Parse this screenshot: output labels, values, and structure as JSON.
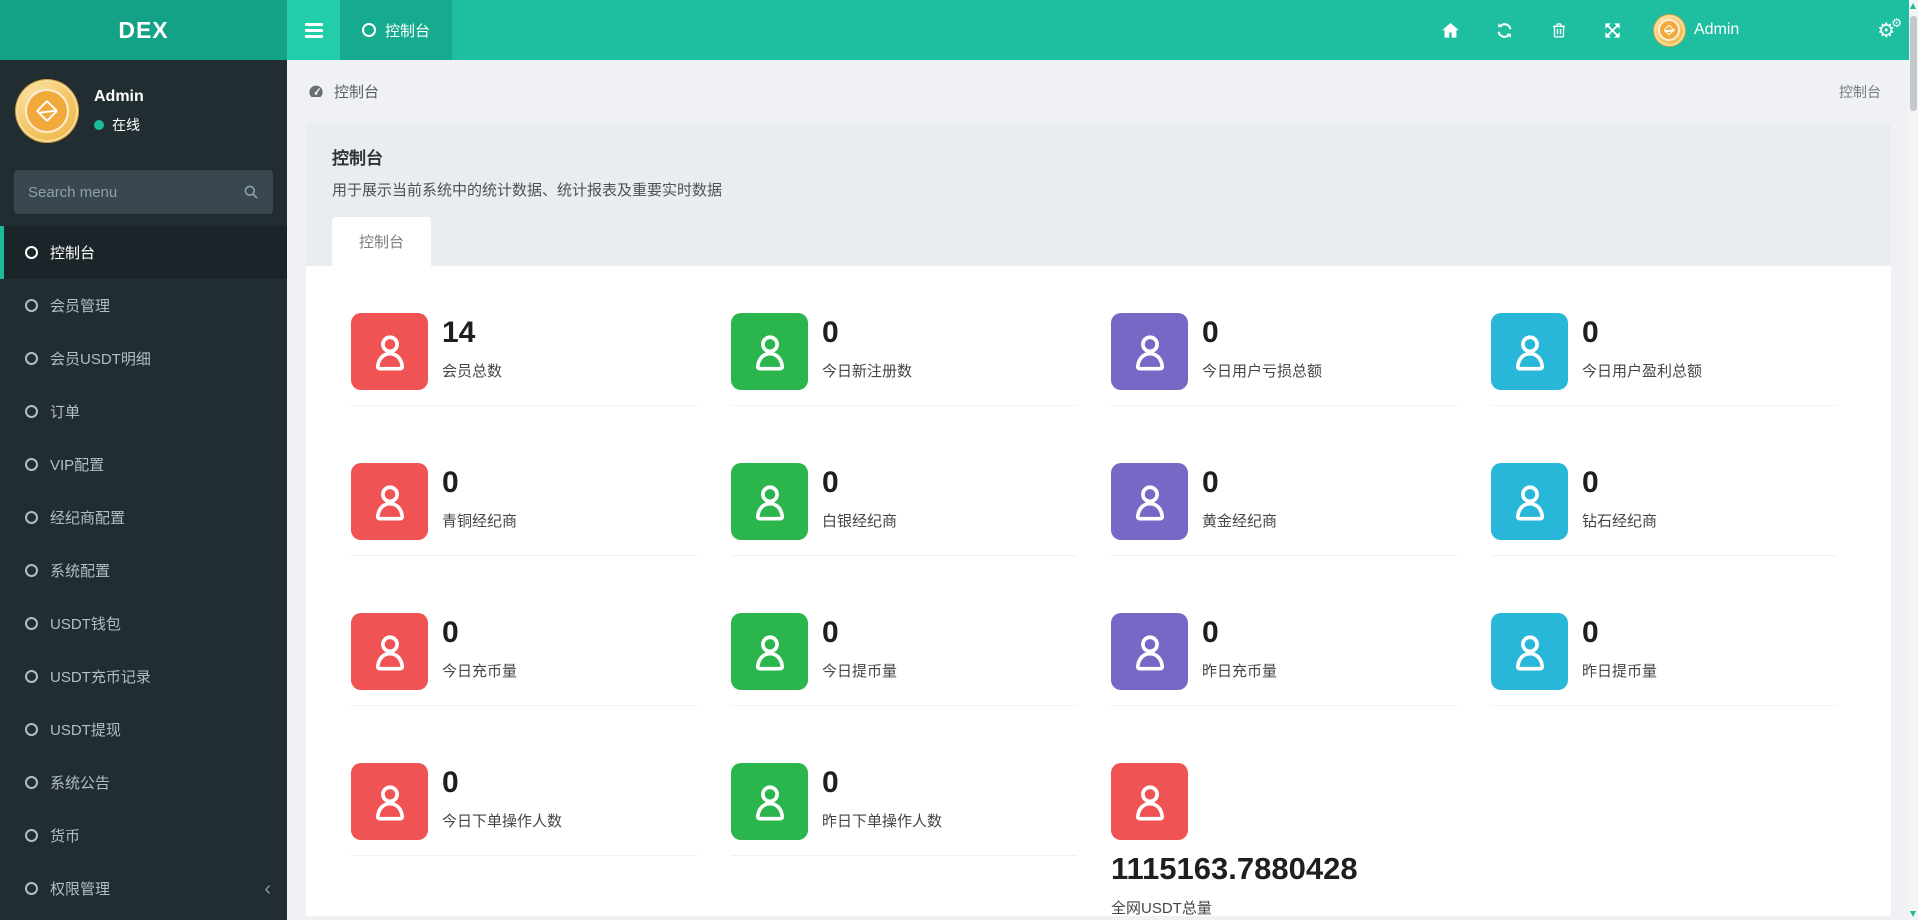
{
  "navbar": {
    "brand": "DEX",
    "tab_label": "控制台",
    "user_name": "Admin",
    "icons": [
      "hamburger-icon",
      "circle-icon",
      "home-icon",
      "refresh-icon",
      "trash-icon",
      "expand-icon",
      "avatar-coin",
      "cogs-icon"
    ]
  },
  "sidebar": {
    "user_name": "Admin",
    "user_status": "在线",
    "search_placeholder": "Search menu",
    "items": [
      {
        "label": "控制台",
        "active": true
      },
      {
        "label": "会员管理"
      },
      {
        "label": "会员USDT明细"
      },
      {
        "label": "订单"
      },
      {
        "label": "VIP配置"
      },
      {
        "label": "经纪商配置"
      },
      {
        "label": "系统配置"
      },
      {
        "label": "USDT钱包"
      },
      {
        "label": "USDT充币记录"
      },
      {
        "label": "USDT提现"
      },
      {
        "label": "系统公告"
      },
      {
        "label": "货币"
      },
      {
        "label": "权限管理",
        "chevron": true
      }
    ]
  },
  "breadcrumb": {
    "current": "控制台",
    "right": "控制台"
  },
  "page_header": {
    "title": "控制台",
    "subtitle": "用于展示当前系统中的统计数据、统计报表及重要实时数据",
    "tab": "控制台"
  },
  "stats": [
    {
      "value": "14",
      "label": "会员总数",
      "color": "red"
    },
    {
      "value": "0",
      "label": "今日新注册数",
      "color": "green"
    },
    {
      "value": "0",
      "label": "今日用户亏损总额",
      "color": "purple"
    },
    {
      "value": "0",
      "label": "今日用户盈利总额",
      "color": "blue"
    },
    {
      "value": "0",
      "label": "青铜经纪商",
      "color": "red"
    },
    {
      "value": "0",
      "label": "白银经纪商",
      "color": "green"
    },
    {
      "value": "0",
      "label": "黄金经纪商",
      "color": "purple"
    },
    {
      "value": "0",
      "label": "钻石经纪商",
      "color": "blue"
    },
    {
      "value": "0",
      "label": "今日充币量",
      "color": "red"
    },
    {
      "value": "0",
      "label": "今日提币量",
      "color": "green"
    },
    {
      "value": "0",
      "label": "昨日充币量",
      "color": "purple"
    },
    {
      "value": "0",
      "label": "昨日提币量",
      "color": "blue"
    },
    {
      "value": "0",
      "label": "今日下单操作人数",
      "color": "red"
    },
    {
      "value": "0",
      "label": "昨日下单操作人数",
      "color": "green"
    },
    {
      "value": "1115163.7880428",
      "label": "全网USDT总量",
      "color": "red",
      "big": true
    }
  ],
  "colors": {
    "red": "#ef5354",
    "green": "#2ab64d",
    "purple": "#7768c5",
    "blue": "#29b7d9",
    "accent": "#1abc9c"
  }
}
